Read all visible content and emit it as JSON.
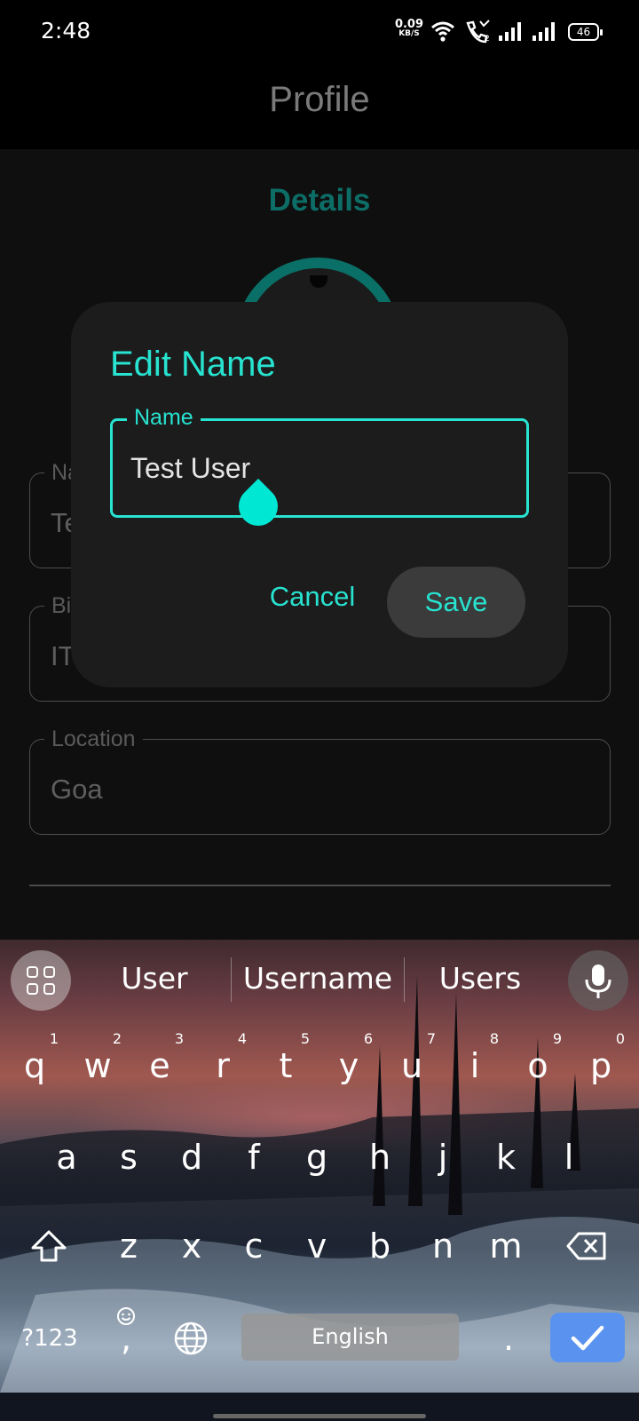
{
  "status_bar": {
    "time": "2:48",
    "net_speed_value": "0.09",
    "net_speed_unit": "KB/S",
    "battery": "46",
    "icons": [
      "wifi-icon",
      "call-icon",
      "signal-icon",
      "signal-icon"
    ]
  },
  "app_bar": {
    "title": "Profile"
  },
  "profile": {
    "section_title": "Details",
    "fields": [
      {
        "label": "Name",
        "value": "Test User"
      },
      {
        "label": "Bio",
        "value": "IT"
      },
      {
        "label": "Location",
        "value": "Goa"
      }
    ]
  },
  "dialog": {
    "title": "Edit Name",
    "field_label": "Name",
    "field_value": "Test User",
    "cancel_label": "Cancel",
    "save_label": "Save"
  },
  "keyboard": {
    "suggestions": [
      "User",
      "Username",
      "Users"
    ],
    "row1": [
      [
        "q",
        "1"
      ],
      [
        "w",
        "2"
      ],
      [
        "e",
        "3"
      ],
      [
        "r",
        "4"
      ],
      [
        "t",
        "5"
      ],
      [
        "y",
        "6"
      ],
      [
        "u",
        "7"
      ],
      [
        "i",
        "8"
      ],
      [
        "o",
        "9"
      ],
      [
        "p",
        "0"
      ]
    ],
    "row2": [
      "a",
      "s",
      "d",
      "f",
      "g",
      "h",
      "j",
      "k",
      "l"
    ],
    "row3": [
      "z",
      "x",
      "c",
      "v",
      "b",
      "n",
      "m"
    ],
    "symbols_label": "?123",
    "comma_label": ",",
    "period_label": ".",
    "space_label": "English"
  },
  "colors": {
    "accent": "#27e3d0",
    "accent_dim": "#0c6e66",
    "dialog_bg": "#1c1c1c",
    "enter_key": "#5a93ef"
  }
}
